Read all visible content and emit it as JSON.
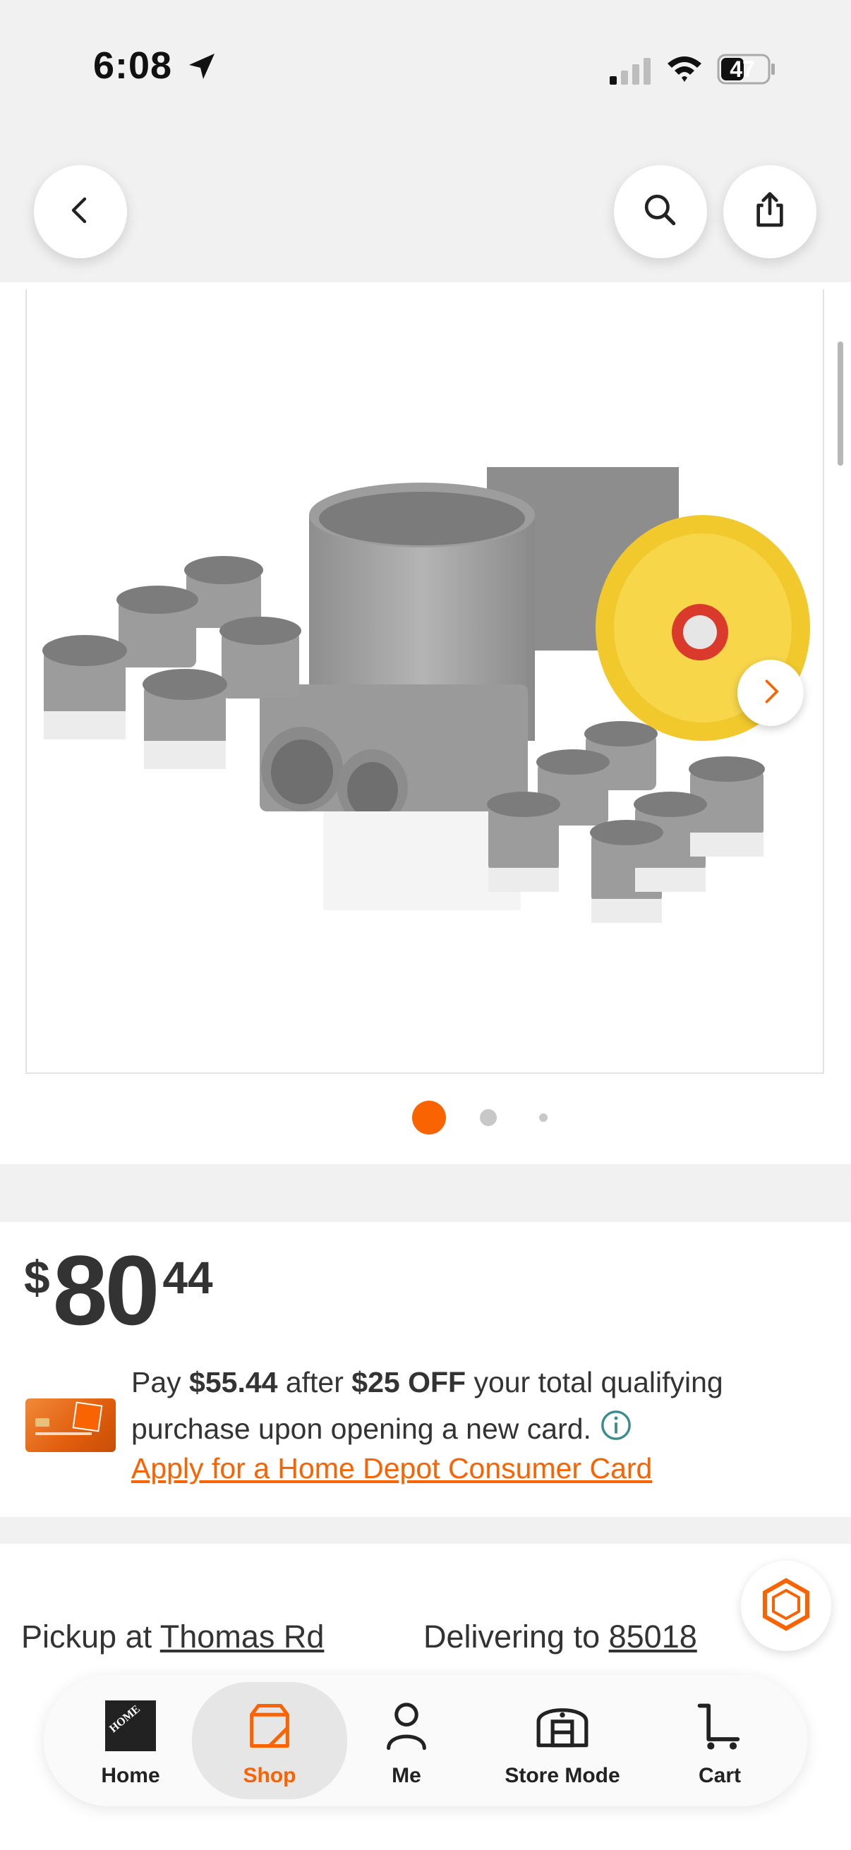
{
  "status_bar": {
    "time": "6:08",
    "battery": "47"
  },
  "product": {
    "price_currency": "$",
    "price_dollars": "80",
    "price_cents": "44",
    "gallery_dots": 3,
    "gallery_active": 1
  },
  "promo": {
    "text_pay": "Pay ",
    "pay_amount": "$55.44",
    "text_after": " after ",
    "discount": "$25 OFF",
    "text_rest": " your total qualifying purchase upon opening a new card.",
    "apply_link": "Apply for a Home Depot Consumer Card"
  },
  "fulfillment": {
    "pickup_label": "Pickup at ",
    "pickup_store": "Thomas Rd",
    "delivery_label": "Delivering to ",
    "delivery_zip": "85018"
  },
  "tabs": [
    {
      "label": "Home"
    },
    {
      "label": "Shop"
    },
    {
      "label": "Me"
    },
    {
      "label": "Store Mode"
    },
    {
      "label": "Cart"
    }
  ],
  "colors": {
    "accent": "#f96302",
    "background": "#f1f1f1",
    "info": "#3c8c8c"
  },
  "icons": [
    "location-arrow-icon",
    "signal-icon",
    "wifi-icon",
    "battery-icon",
    "back-icon",
    "search-icon",
    "share-icon",
    "chevron-right-icon",
    "info-icon",
    "chat-icon",
    "home-depot-logo-icon",
    "shop-icon",
    "person-icon",
    "store-icon",
    "cart-icon"
  ]
}
